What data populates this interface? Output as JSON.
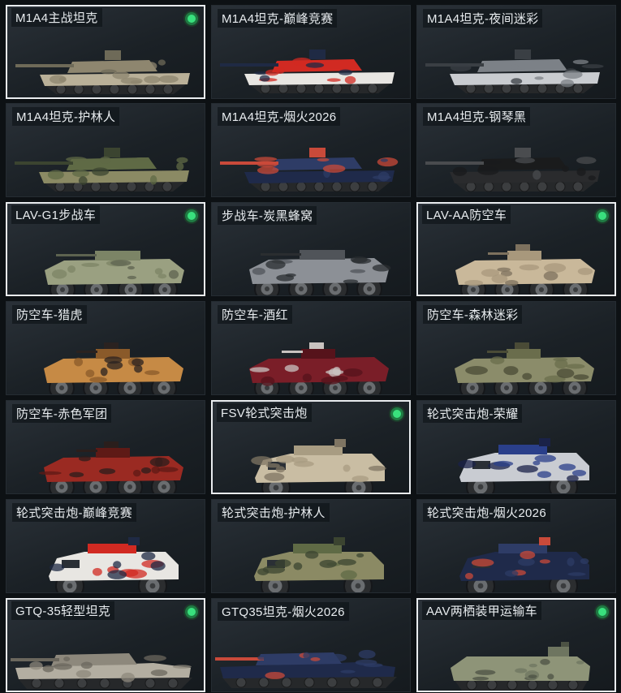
{
  "vehicles": [
    {
      "label": "M1A4主战坦克",
      "kind": "tank",
      "scheme": "desert",
      "selected": true,
      "owned": true
    },
    {
      "label": "M1A4坦克-巅峰竞赛",
      "kind": "tank",
      "scheme": "race",
      "selected": false,
      "owned": false
    },
    {
      "label": "M1A4坦克-夜间迷彩",
      "kind": "tank",
      "scheme": "night",
      "selected": false,
      "owned": false
    },
    {
      "label": "M1A4坦克-护林人",
      "kind": "tank",
      "scheme": "forest",
      "selected": false,
      "owned": false
    },
    {
      "label": "M1A4坦克-烟火2026",
      "kind": "tank",
      "scheme": "fireworks",
      "selected": false,
      "owned": false
    },
    {
      "label": "M1A4坦克-钢琴黑",
      "kind": "tank",
      "scheme": "black",
      "selected": false,
      "owned": false
    },
    {
      "label": "LAV-G1步战车",
      "kind": "ifv",
      "scheme": "olive",
      "selected": true,
      "owned": true
    },
    {
      "label": "步战车-炭黑蜂窝",
      "kind": "ifv",
      "scheme": "hex",
      "selected": false,
      "owned": false
    },
    {
      "label": "LAV-AA防空车",
      "kind": "aa",
      "scheme": "sand",
      "selected": true,
      "owned": true
    },
    {
      "label": "防空车-猎虎",
      "kind": "aa",
      "scheme": "tiger",
      "selected": false,
      "owned": false
    },
    {
      "label": "防空车-酒红",
      "kind": "aa",
      "scheme": "wine",
      "selected": false,
      "owned": false
    },
    {
      "label": "防空车-森林迷彩",
      "kind": "aa",
      "scheme": "woodland",
      "selected": false,
      "owned": false
    },
    {
      "label": "防空车-赤色军团",
      "kind": "aa",
      "scheme": "crimson",
      "selected": false,
      "owned": false
    },
    {
      "label": "FSV轮式突击炮",
      "kind": "fsv",
      "scheme": "tan",
      "selected": true,
      "owned": true
    },
    {
      "label": "轮式突击炮-荣耀",
      "kind": "fsv",
      "scheme": "glory",
      "selected": false,
      "owned": false
    },
    {
      "label": "轮式突击炮-巅峰竞赛",
      "kind": "fsv",
      "scheme": "race",
      "selected": false,
      "owned": false
    },
    {
      "label": "轮式突击炮-护林人",
      "kind": "fsv",
      "scheme": "forest",
      "selected": false,
      "owned": false
    },
    {
      "label": "轮式突击炮-烟火2026",
      "kind": "fsv",
      "scheme": "fireworks",
      "selected": false,
      "owned": false
    },
    {
      "label": "GTQ-35轻型坦克",
      "kind": "light",
      "scheme": "stone",
      "selected": true,
      "owned": true
    },
    {
      "label": "GTQ35坦克-烟火2026",
      "kind": "light",
      "scheme": "fireworks",
      "selected": false,
      "owned": false
    },
    {
      "label": "AAV两栖装甲运输车",
      "kind": "aav",
      "scheme": "green",
      "selected": true,
      "owned": true
    }
  ],
  "decal_text": "2026",
  "colors": {
    "desert": [
      "#b9b098",
      "#8e866f",
      "#6e6a58"
    ],
    "race": [
      "#e8e6e2",
      "#d12a22",
      "#1f2a44"
    ],
    "night": [
      "#c9ccd0",
      "#7c8187",
      "#3a3f44"
    ],
    "forest": [
      "#8b8a64",
      "#5f6a45",
      "#3b4430"
    ],
    "fireworks": [
      "#1f2a4a",
      "#2e3c66",
      "#c94a3a"
    ],
    "black": [
      "#2a2b2d",
      "#1a1b1c",
      "#4a4c4f"
    ],
    "olive": [
      "#9aa081",
      "#7c8466",
      "#5d6350"
    ],
    "hex": [
      "#8c9096",
      "#505459",
      "#2a2d30"
    ],
    "sand": [
      "#c9b89a",
      "#a8987c",
      "#7d715e"
    ],
    "tiger": [
      "#c68a45",
      "#8a5a2a",
      "#2a2220"
    ],
    "wine": [
      "#7a1e28",
      "#56131b",
      "#c9c3c0"
    ],
    "woodland": [
      "#8b8c6a",
      "#6a6d4c",
      "#4a4b36"
    ],
    "crimson": [
      "#9a2a22",
      "#5e1a16",
      "#2a1e1c"
    ],
    "tan": [
      "#c9bda3",
      "#a89c82",
      "#7f7563"
    ],
    "glory": [
      "#c9ccd2",
      "#2a3f8a",
      "#1a2248"
    ],
    "stone": [
      "#b3aea1",
      "#8d887c",
      "#6b675d"
    ],
    "green": [
      "#8e9478",
      "#6e7560",
      "#4c5244"
    ],
    "wheel": "#2b2d2f",
    "hub": "#6a6d70",
    "status_green": "#39e07d"
  }
}
